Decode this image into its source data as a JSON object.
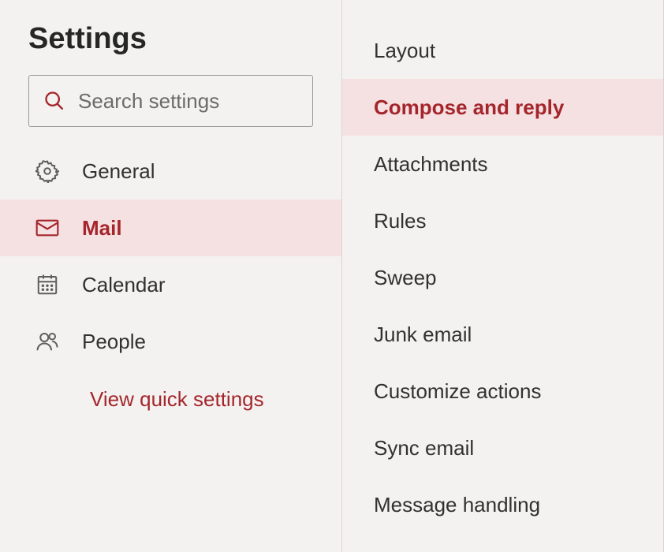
{
  "header": {
    "title": "Settings"
  },
  "search": {
    "placeholder": "Search settings"
  },
  "nav": {
    "items": [
      {
        "label": "General",
        "selected": false
      },
      {
        "label": "Mail",
        "selected": true
      },
      {
        "label": "Calendar",
        "selected": false
      },
      {
        "label": "People",
        "selected": false
      }
    ],
    "quick_settings_label": "View quick settings"
  },
  "sub": {
    "items": [
      {
        "label": "Layout",
        "selected": false
      },
      {
        "label": "Compose and reply",
        "selected": true
      },
      {
        "label": "Attachments",
        "selected": false
      },
      {
        "label": "Rules",
        "selected": false
      },
      {
        "label": "Sweep",
        "selected": false
      },
      {
        "label": "Junk email",
        "selected": false
      },
      {
        "label": "Customize actions",
        "selected": false
      },
      {
        "label": "Sync email",
        "selected": false
      },
      {
        "label": "Message handling",
        "selected": false
      }
    ]
  },
  "colors": {
    "accent": "#a4262c",
    "selected_bg": "#f5e1e2"
  }
}
